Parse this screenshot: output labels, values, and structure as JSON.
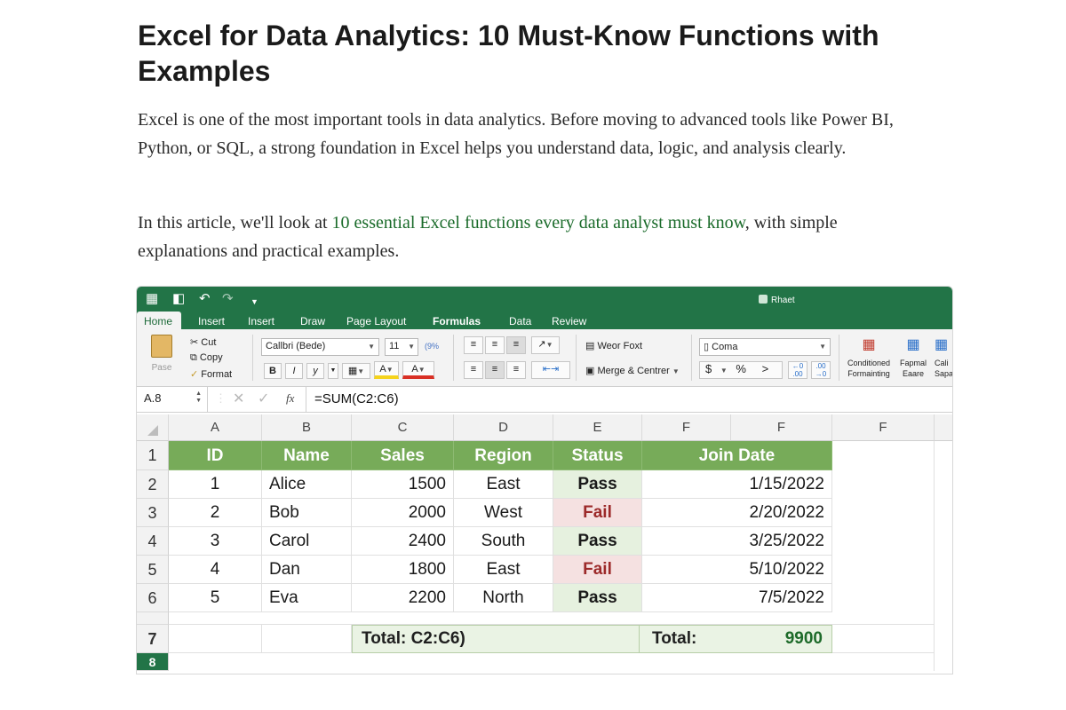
{
  "article": {
    "title": "Excel for Data Analytics: 10 Must-Know Functions with Examples",
    "intro": "Excel is one of the most important tools in data analytics. Before moving to advanced tools like Power BI, Python, or SQL, a strong foundation in Excel helps you understand data, logic, and analysis clearly.",
    "p2_before": "In this article, we'll look at ",
    "p2_link": "10 essential Excel functions every data analyst must know",
    "p2_after": ", with simple explanations and practical examples."
  },
  "excel": {
    "window_label": "Rhaet",
    "tabs": [
      "Home",
      "Insert",
      "Insert",
      "Draw",
      "Page Layout",
      "Formulas",
      "Data",
      "Review"
    ],
    "ribbon": {
      "paste": "Pase",
      "cut": "Cut",
      "copy": "Copy",
      "format": "Format",
      "font_name": "Callbri (Bede)",
      "font_size": "11",
      "pct_box": "(9%",
      "bold": "B",
      "italic": "I",
      "underline": "y",
      "fill_letter": "A",
      "font_letter": "A",
      "wrap_text": "Weor Foxt",
      "merge_center": "Merge & Centrer",
      "number_format": "Coma",
      "currency": "$",
      "percent": "%",
      "comma_style": ">",
      "conditional_1": "Conditioned",
      "conditional_2": "Formainting",
      "format_1": "Fapmal",
      "format_2": "Eaare",
      "cell_1": "Cali",
      "cell_2": "Sapa"
    },
    "formula_bar": {
      "name_box": "A.8",
      "fx": "fx",
      "formula": "=SUM(C2:C6)"
    },
    "columns": [
      "A",
      "B",
      "C",
      "D",
      "E",
      "F",
      "F",
      "F"
    ],
    "rows": [
      "1",
      "2",
      "3",
      "4",
      "5",
      "6",
      "",
      "7",
      "8"
    ],
    "headers": [
      "ID",
      "Name",
      "Sales",
      "Region",
      "Status",
      "Join Date"
    ],
    "data": [
      [
        "1",
        "Alice",
        "1500",
        "East",
        "Pass",
        "1/15/2022"
      ],
      [
        "2",
        "Bob",
        "2000",
        "West",
        "Fail",
        "2/20/2022"
      ],
      [
        "3",
        "Carol",
        "2400",
        "South",
        "Pass",
        "3/25/2022"
      ],
      [
        "4",
        "Dan",
        "1800",
        "East",
        "Fail",
        "5/10/2022"
      ],
      [
        "5",
        "Eva",
        "2200",
        "North",
        "Pass",
        "7/5/2022"
      ]
    ],
    "total_label": "Total: C2:C6)",
    "total_label2": "Total:",
    "total_value": "9900",
    "colors": {
      "titlebar": "#227447",
      "header_fill": "#77ab59",
      "pass_fill": "#e6f1df",
      "fail_fill": "#f5e1e1",
      "fail_text": "#9c2a2a",
      "total_fill": "#eaf3e4"
    }
  }
}
